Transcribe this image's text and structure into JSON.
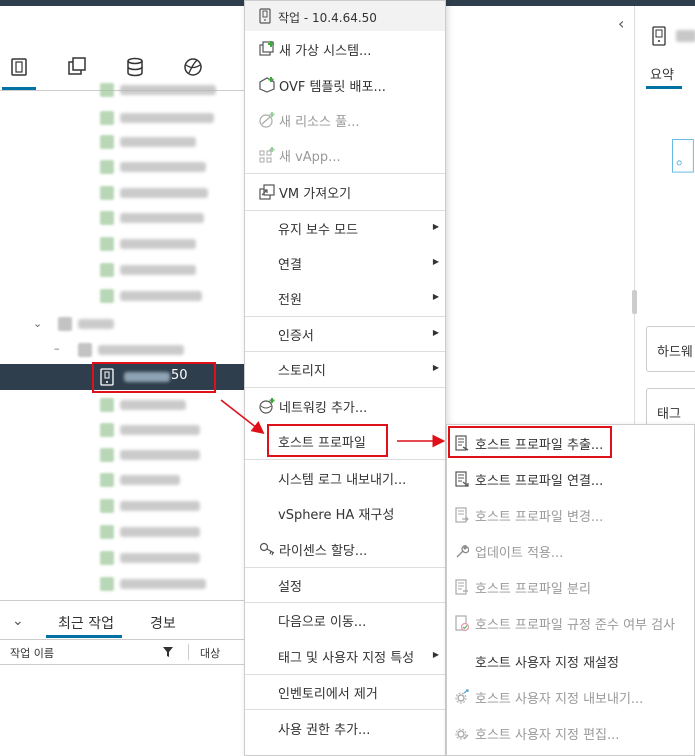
{
  "menu": {
    "header": "작업 - 10.4.64.50",
    "items": [
      {
        "label": "새 가상 시스템...",
        "disabled": false
      },
      {
        "label": "OVF 템플릿 배포...",
        "disabled": false
      },
      {
        "label": "새 리소스 풀...",
        "disabled": true
      },
      {
        "label": "새 vApp...",
        "disabled": true
      },
      {
        "label": "VM 가져오기",
        "disabled": false
      },
      {
        "label": "유지 보수 모드",
        "disabled": false
      },
      {
        "label": "연결",
        "disabled": false
      },
      {
        "label": "전원",
        "disabled": false
      },
      {
        "label": "인증서",
        "disabled": false
      },
      {
        "label": "스토리지",
        "disabled": false
      },
      {
        "label": "네트워킹 추가...",
        "disabled": false
      },
      {
        "label": "호스트 프로파일",
        "disabled": false
      },
      {
        "label": "시스템 로그 내보내기...",
        "disabled": false
      },
      {
        "label": "vSphere HA 재구성",
        "disabled": false
      },
      {
        "label": "라이센스 할당...",
        "disabled": false
      },
      {
        "label": "설정",
        "disabled": false
      },
      {
        "label": "다음으로 이동...",
        "disabled": false
      },
      {
        "label": "태그 및 사용자 지정 특성",
        "disabled": false
      },
      {
        "label": "인벤토리에서 제거",
        "disabled": false
      },
      {
        "label": "사용 권한 추가...",
        "disabled": false
      }
    ]
  },
  "submenu": {
    "items": [
      {
        "label": "호스트 프로파일 추출...",
        "disabled": false
      },
      {
        "label": "호스트 프로파일 연결...",
        "disabled": false
      },
      {
        "label": "호스트 프로파일 변경...",
        "disabled": true
      },
      {
        "label": "업데이트 적용...",
        "disabled": true
      },
      {
        "label": "호스트 프로파일 분리",
        "disabled": true
      },
      {
        "label": "호스트 프로파일 규정 준수 여부 검사",
        "disabled": true
      },
      {
        "label": "호스트 사용자 지정 재설정",
        "disabled": false
      },
      {
        "label": "호스트 사용자 지정 내보내기...",
        "disabled": true
      },
      {
        "label": "호스트 사용자 지정 편집...",
        "disabled": true
      }
    ]
  },
  "tree": {
    "selected_suffix": "50"
  },
  "tasks_panel": {
    "tab_recent": "최근 작업",
    "tab_alarms": "경보",
    "col_task_name": "작업 이름",
    "col_target": "대상"
  },
  "right_panel": {
    "tab_summary": "요약",
    "card_hardware": "하드웨",
    "card_tags": "태그"
  },
  "colors": {
    "accent": "#0072a3",
    "selected_row": "#2f3e4c",
    "highlight": "#e0101a"
  }
}
